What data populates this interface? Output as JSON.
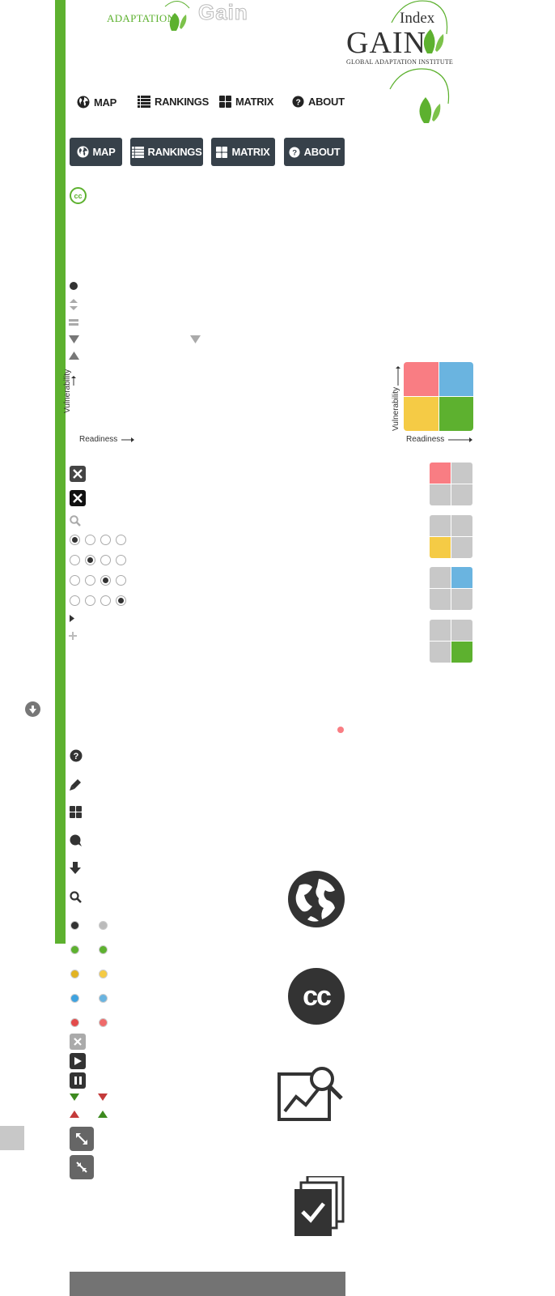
{
  "logo": {
    "adaptation_text": "ADAPTATION",
    "ghost_text": "Gain",
    "index_text": "Index",
    "gain_text": "GAIN",
    "institute_text": "GLOBAL ADAPTATION INSTITUTE"
  },
  "nav_plain": [
    {
      "label": "MAP",
      "icon": "globe-icon"
    },
    {
      "label": "RANKINGS",
      "icon": "list-icon"
    },
    {
      "label": "MATRIX",
      "icon": "grid-icon"
    },
    {
      "label": "ABOUT",
      "icon": "question-icon"
    }
  ],
  "nav_buttons": [
    {
      "label": "MAP",
      "icon": "globe-icon"
    },
    {
      "label": "RANKINGS",
      "icon": "list-icon"
    },
    {
      "label": "MATRIX",
      "icon": "grid-icon"
    },
    {
      "label": "ABOUT",
      "icon": "question-icon"
    }
  ],
  "cc_small": "cc",
  "cc_large": "cc",
  "matrix_legend": {
    "y_axis": "Vulnerability",
    "x_axis": "Readiness"
  },
  "matrix_legend_large": {
    "y_axis": "Vulnerability",
    "x_axis": "Readiness"
  },
  "colors": {
    "green_bar": "#5db12f",
    "nav_button_bg": "#37414a",
    "quad_red": "#f97d83",
    "quad_blue": "#6ab4e0",
    "quad_yellow": "#f5cb45",
    "quad_green": "#5db12f",
    "grey_cell": "#c8c8c8",
    "footer_bg": "#737373"
  }
}
